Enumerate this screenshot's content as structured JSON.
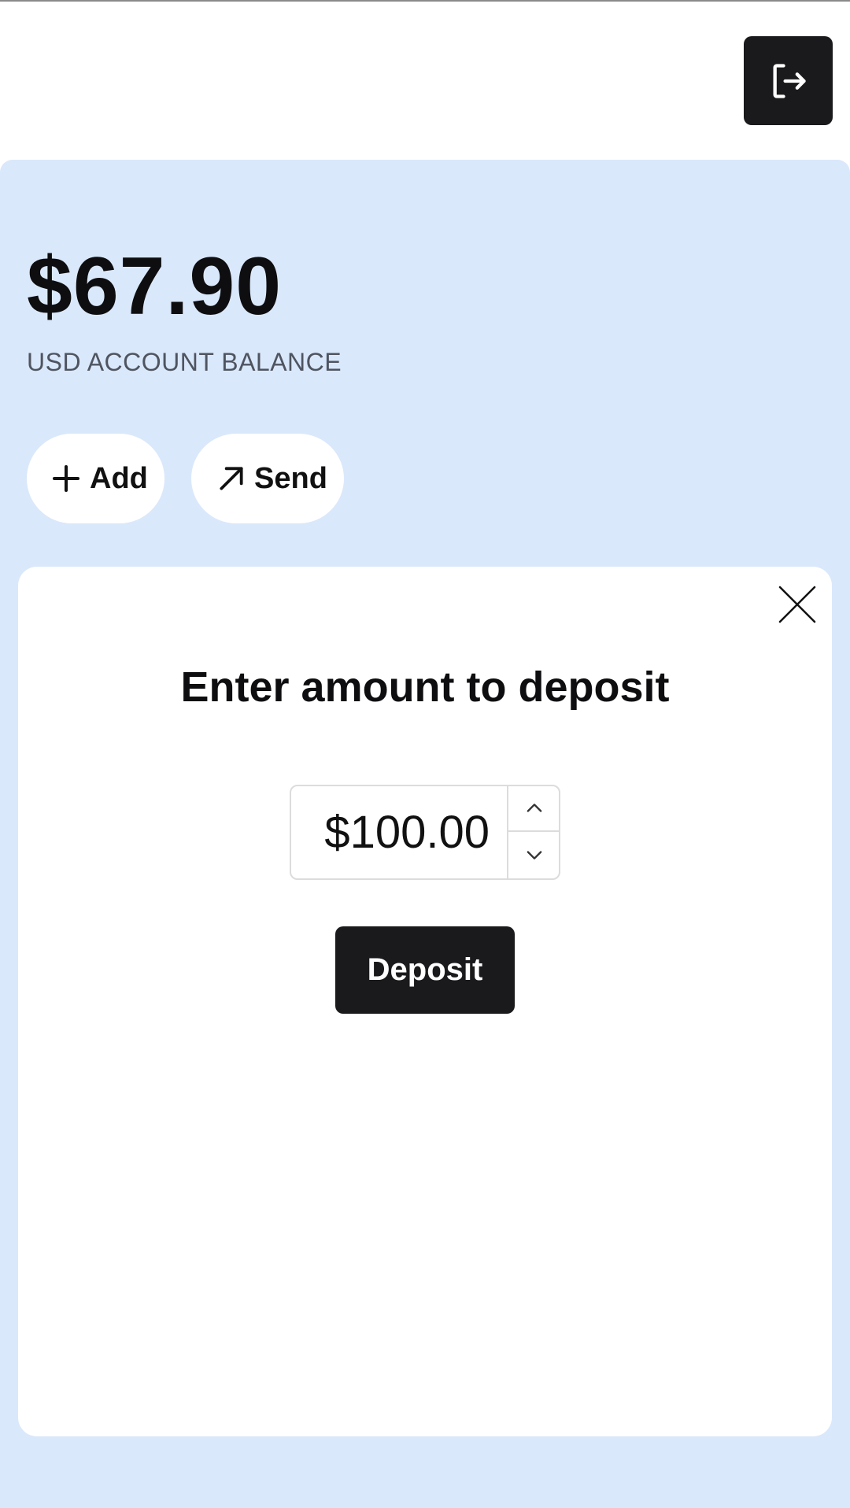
{
  "header": {
    "logout_icon": "logout-icon"
  },
  "account": {
    "balance": "$67.90",
    "label": "USD ACCOUNT BALANCE"
  },
  "actions": {
    "add_label": "Add",
    "add_icon": "plus-icon",
    "send_label": "Send",
    "send_icon": "arrow-up-right-icon"
  },
  "modal": {
    "title": "Enter amount to deposit",
    "amount_value": "$100.00",
    "deposit_label": "Deposit",
    "close_icon": "close-icon"
  },
  "colors": {
    "panel_bg": "#dae8fb",
    "dark_button": "#1a1a1c",
    "text_primary": "#0e0e10",
    "text_secondary": "#4f5560"
  }
}
